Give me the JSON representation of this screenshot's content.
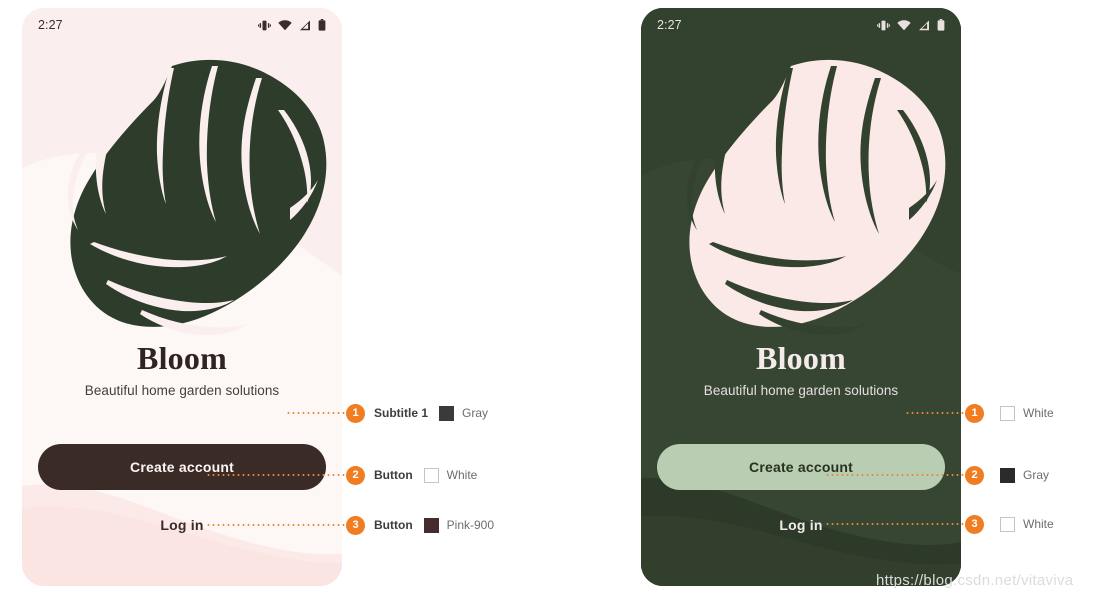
{
  "watermark": "https://blog.csdn.net/vitaviva",
  "phones": [
    {
      "id": "light",
      "theme_name": "light-theme-phone",
      "status": {
        "time": "2:27",
        "icons": [
          "vibrate-icon",
          "wifi-icon",
          "cellular-signal-icon",
          "battery-icon"
        ]
      },
      "title": "Bloom",
      "subtitle": "Beautiful home garden solutions",
      "primary_button": "Create account",
      "text_button": "Log in",
      "annotations": [
        {
          "number": "1",
          "label": "Subtitle 1",
          "color_name": "Gray",
          "swatch": "#3a3a3a",
          "swatch_style": "filled"
        },
        {
          "number": "2",
          "label": "Button",
          "color_name": "White",
          "swatch": "#ffffff",
          "swatch_style": "outlined"
        },
        {
          "number": "3",
          "label": "Button",
          "color_name": "Pink-900",
          "swatch": "#442c2e",
          "swatch_style": "filled"
        }
      ]
    },
    {
      "id": "dark",
      "theme_name": "dark-theme-phone",
      "status": {
        "time": "2:27",
        "icons": [
          "vibrate-icon",
          "wifi-icon",
          "cellular-signal-icon",
          "battery-icon"
        ]
      },
      "title": "Bloom",
      "subtitle": "Beautiful home garden solutions",
      "primary_button": "Create account",
      "text_button": "Log in",
      "annotations": [
        {
          "number": "1",
          "label": "",
          "color_name": "White",
          "swatch": "#ffffff",
          "swatch_style": "outlined"
        },
        {
          "number": "2",
          "label": "",
          "color_name": "Gray",
          "swatch": "#2b2b2b",
          "swatch_style": "filled"
        },
        {
          "number": "3",
          "label": "",
          "color_name": "White",
          "swatch": "#ffffff",
          "swatch_style": "outlined"
        }
      ]
    }
  ],
  "colors": {
    "accent_orange": "#f07d22",
    "light_bg_pink": "#fbeeee",
    "light_bg_cream": "#fdf6f4",
    "leaf_dark_green": "#2e3c2c",
    "dark_bg_green": "#33412f",
    "dark_bg_green_alt": "#3c4a37",
    "leaf_light_pink": "#fbe9e7",
    "primary_dark_button": "#3b2b27",
    "primary_sage_button": "#b9cdb3"
  }
}
